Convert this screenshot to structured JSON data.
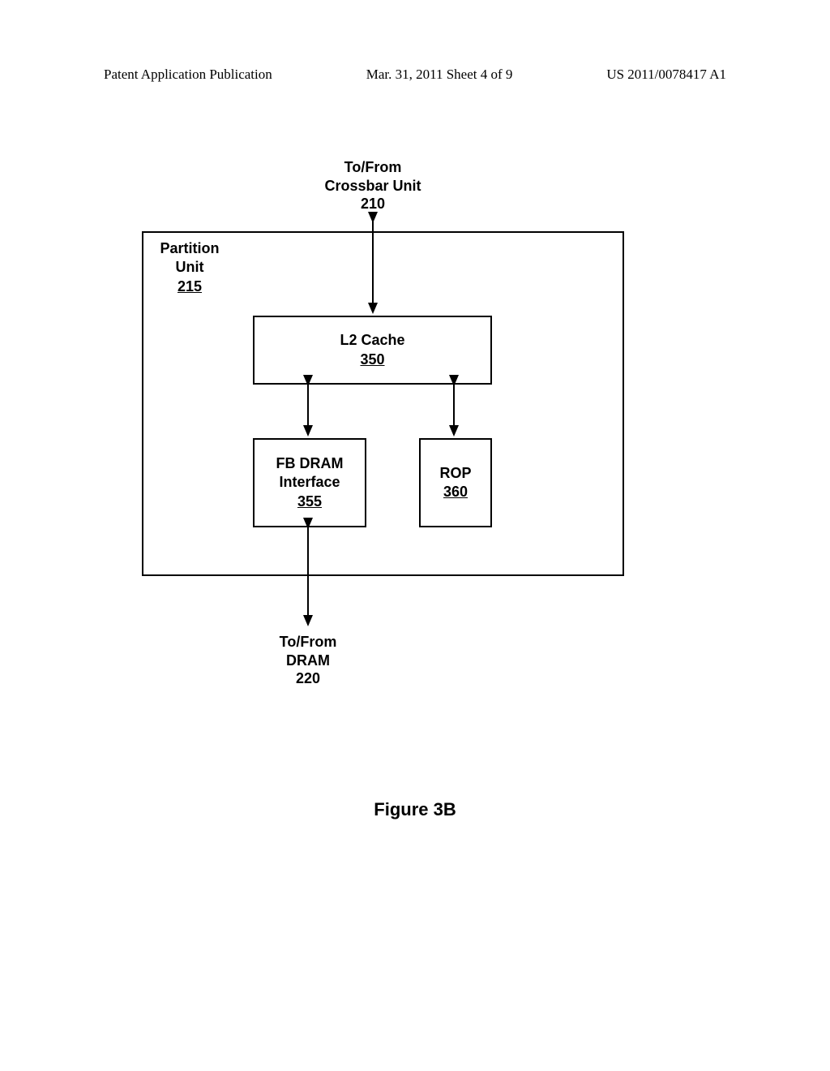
{
  "header": {
    "left": "Patent Application Publication",
    "center": "Mar. 31, 2011 Sheet 4 of 9",
    "right": "US 2011/0078417 A1"
  },
  "top_label": {
    "line1": "To/From",
    "line2": "Crossbar Unit",
    "line3": "210"
  },
  "partition": {
    "line1": "Partition",
    "line2": "Unit",
    "num": "215"
  },
  "l2": {
    "name": "L2 Cache",
    "num": "350"
  },
  "fb": {
    "line1": "FB DRAM",
    "line2": "Interface",
    "num": "355"
  },
  "rop": {
    "name": "ROP",
    "num": "360"
  },
  "bottom_label": {
    "line1": "To/From",
    "line2": "DRAM",
    "line3": "220"
  },
  "figure_label": "Figure 3B"
}
